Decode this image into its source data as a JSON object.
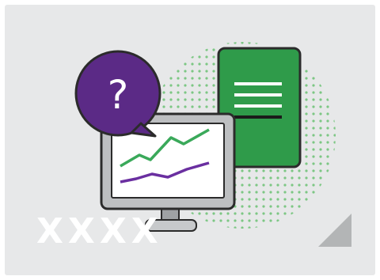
{
  "card": {
    "label": "XXXX"
  },
  "icons": {
    "bubble": "question-bubble-icon",
    "monitor": "monitor-chart-icon",
    "document": "document-icon",
    "corner": "corner-triangle-icon"
  },
  "colors": {
    "background": "#e7e8e9",
    "purple": "#5b2a86",
    "green": "#2f9b4a",
    "light_green": "#8fcf92",
    "outline": "#2b2b2b",
    "monitor_frame": "#bdbfc1",
    "corner": "#b3b5b6"
  },
  "bubble_text": "?"
}
